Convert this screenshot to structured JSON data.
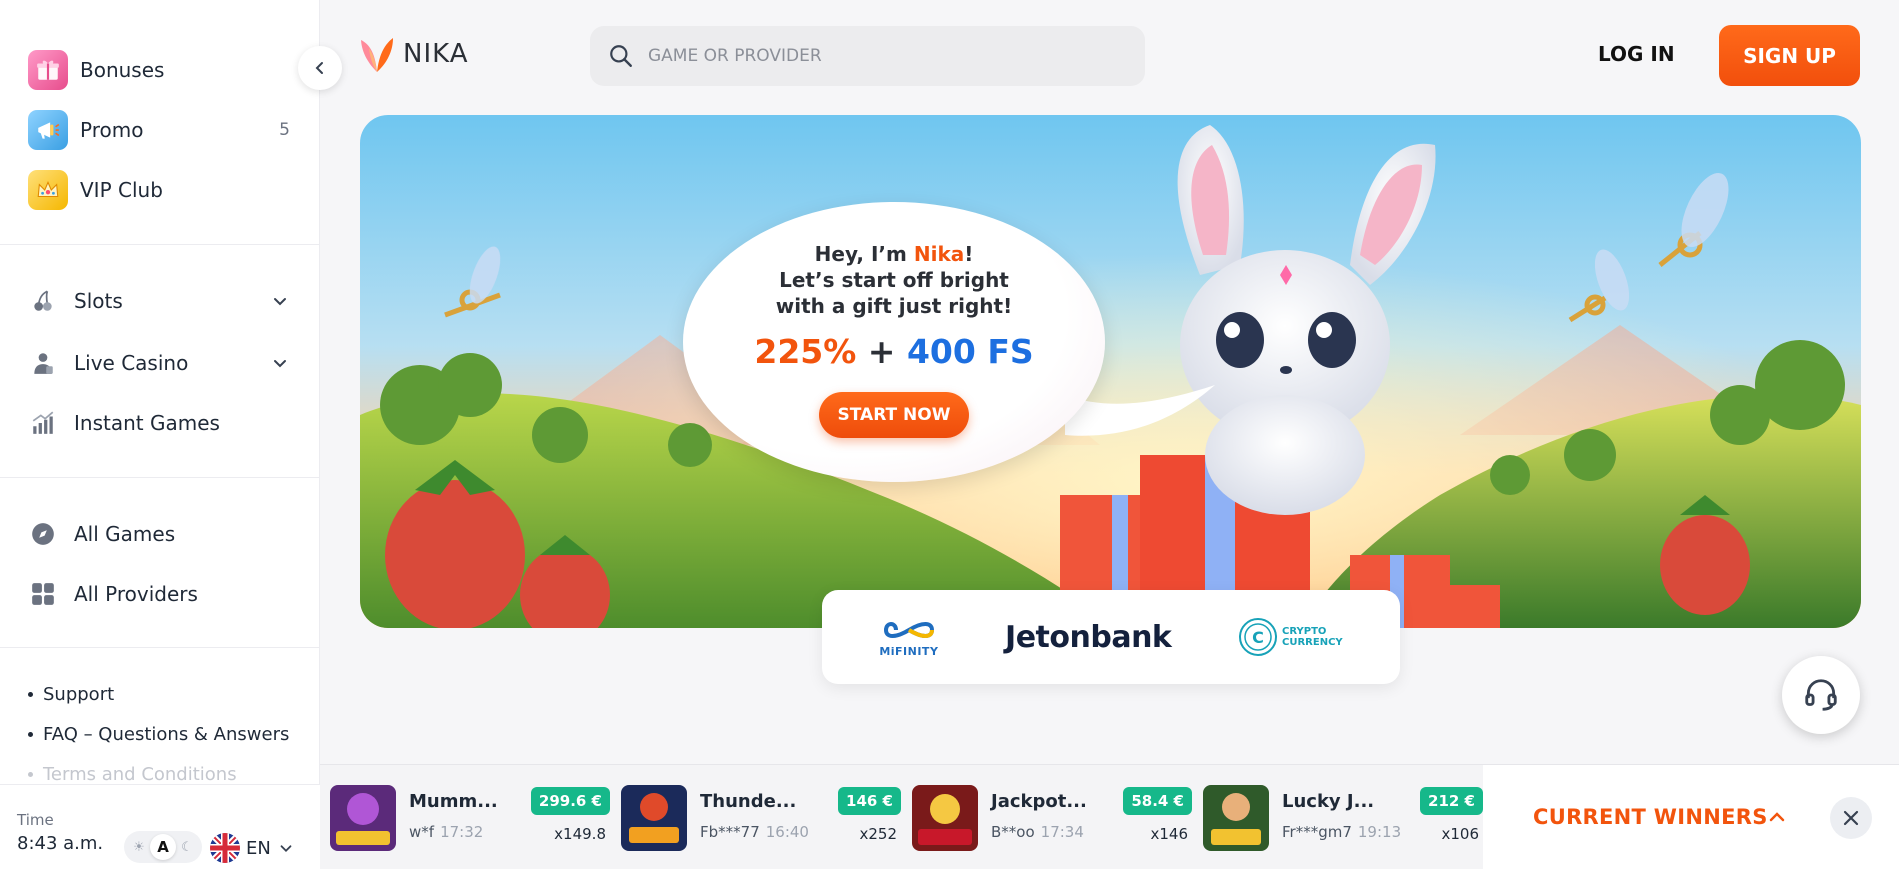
{
  "sidebar": {
    "top_items": [
      {
        "label": "Bonuses",
        "icon": "gift-icon"
      },
      {
        "label": "Promo",
        "icon": "megaphone-icon",
        "badge": "5"
      },
      {
        "label": "VIP Club",
        "icon": "crown-icon"
      }
    ],
    "game_items": [
      {
        "label": "Slots",
        "icon": "cherries-icon"
      },
      {
        "label": "Live Casino",
        "icon": "dealer-icon"
      },
      {
        "label": "Instant Games",
        "icon": "chart-up-icon"
      }
    ],
    "catalog_items": [
      {
        "label": "All Games",
        "icon": "compass-icon"
      },
      {
        "label": "All Providers",
        "icon": "grid-icon"
      }
    ],
    "links": [
      "Support",
      "FAQ – Questions & Answers",
      "Terms and Conditions"
    ],
    "footer": {
      "time_label": "Time",
      "time_value": "8:43 a.m.",
      "theme_auto": "A",
      "language": "EN"
    }
  },
  "header": {
    "logo_text": "NIKA",
    "search_placeholder": "GAME OR PROVIDER",
    "login_label": "LOG IN",
    "signup_label": "SIGN UP"
  },
  "banner": {
    "greeting_prefix": "Hey, I’m ",
    "greeting_name": "Nika",
    "greeting_suffix": "!",
    "line2": "Let’s start off bright",
    "line3": "with a gift just right!",
    "offer_percent": "225%",
    "offer_plus": " + ",
    "offer_fs": "400 FS",
    "cta_label": "START NOW"
  },
  "payments": {
    "mifinity": "MiFINITY",
    "jetonbank": "Jetonbank",
    "crypto_line1": "CRYPTO",
    "crypto_line2": "CURRENCY"
  },
  "winners": {
    "title": "CURRENT WINNERS",
    "items": [
      {
        "game": "Mumm...",
        "user": "w*f",
        "time": "17:32",
        "amount": "299.6 €",
        "multiplier": "x149.8"
      },
      {
        "game": "Thunde...",
        "user": "Fb***77",
        "time": "16:40",
        "amount": "146 €",
        "multiplier": "x252"
      },
      {
        "game": "Jackpot...",
        "user": "B**oo",
        "time": "17:34",
        "amount": "58.4 €",
        "multiplier": "x146"
      },
      {
        "game": "Lucky J...",
        "user": "Fr***gm7",
        "time": "19:13",
        "amount": "212 €",
        "multiplier": "x106"
      }
    ]
  },
  "colors": {
    "accent": "#f2540d",
    "offer_blue": "#1d6fe0",
    "win_green": "#16b88a"
  }
}
